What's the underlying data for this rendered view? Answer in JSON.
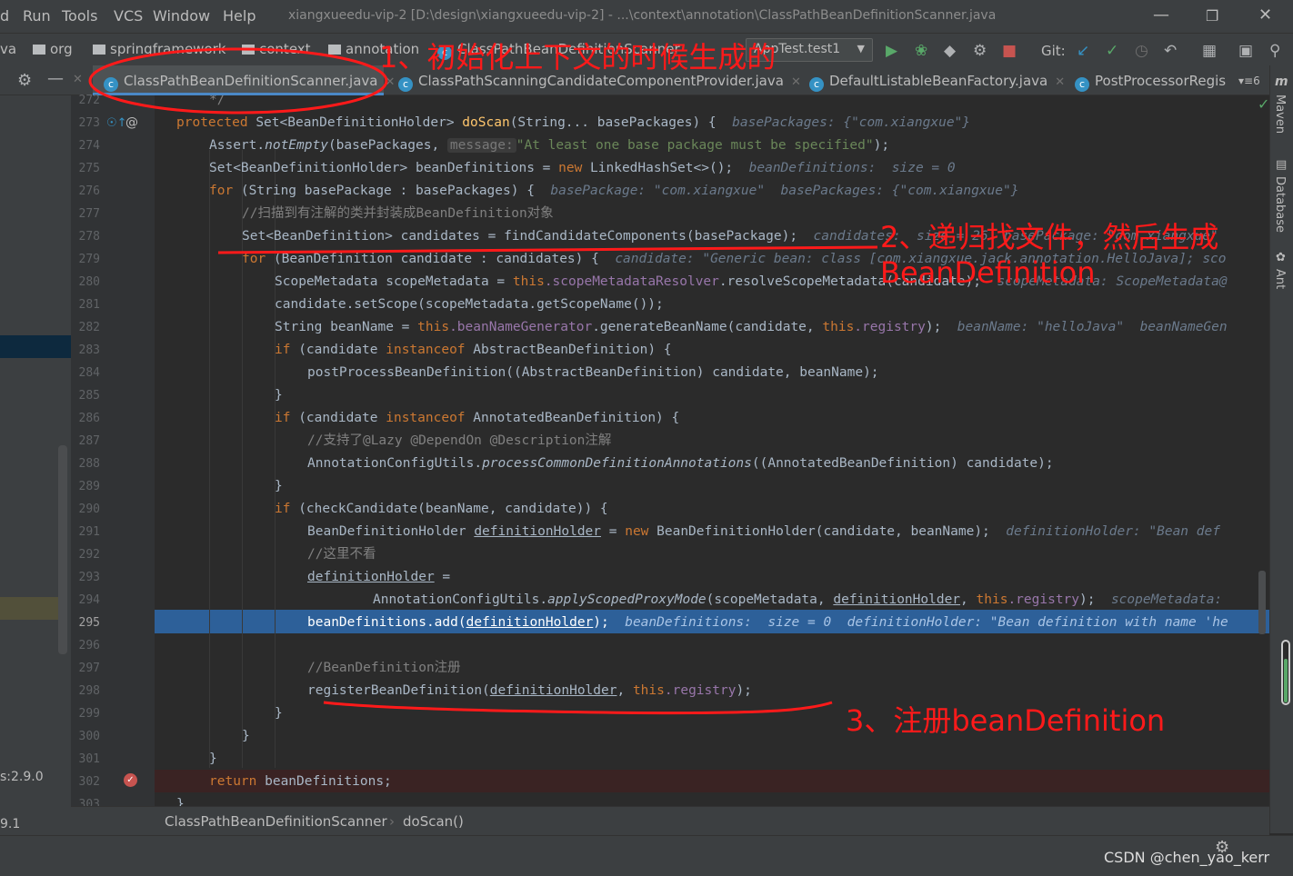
{
  "menu": {
    "items": [
      "d",
      "Run",
      "Tools",
      "VCS",
      "Window",
      "Help"
    ]
  },
  "window_title": "xiangxueedu-vip-2 [D:\\design\\xiangxueedu-vip-2] - ...\\context\\annotation\\ClassPathBeanDefinitionScanner.java",
  "breadcrumbs": [
    "va",
    "org",
    "springframework",
    "context",
    "annotation",
    "ClassPathBeanDefinitionScanner"
  ],
  "run_config": "AppTest.test1",
  "git_label": "Git:",
  "tabs": [
    {
      "label": "ClassPathBeanDefinitionScanner.java",
      "icon": "c"
    },
    {
      "label": "ClassPathScanningCandidateComponentProvider.java",
      "icon": "c"
    },
    {
      "label": "DefaultListableBeanFactory.java",
      "icon": "c"
    },
    {
      "label": "PostProcessorRegis",
      "icon": "c"
    }
  ],
  "tab_overflow": "6",
  "right_panels": [
    "Maven",
    "Database",
    "Ant"
  ],
  "left_panel_texts": [
    "s:2.9.0",
    "9.1"
  ],
  "status_breadcrumb": [
    "ClassPathBeanDefinitionScanner",
    "doScan()"
  ],
  "line_numbers": [
    "272",
    "273",
    "274",
    "275",
    "276",
    "277",
    "278",
    "279",
    "280",
    "281",
    "282",
    "283",
    "284",
    "285",
    "286",
    "287",
    "288",
    "289",
    "290",
    "291",
    "292",
    "293",
    "294",
    "295",
    "296",
    "297",
    "298",
    "299",
    "300",
    "301",
    "302",
    "303"
  ],
  "code": {
    "l272": "*/",
    "l273_a": "protected ",
    "l273_b": "Set<BeanDefinitionHolder> ",
    "l273_c": "doScan",
    "l273_d": "(String... basePackages) {  ",
    "l273_hint": "basePackages: {\"com.xiangxue\"}",
    "l274_a": "Assert.",
    "l274_b": "notEmpty",
    "l274_c": "(basePackages, ",
    "l274_param": "message:",
    "l274_str": "\"At least one base package must be specified\"",
    "l274_d": ");",
    "l275_a": "Set<BeanDefinitionHolder> beanDefinitions = ",
    "l275_new": "new ",
    "l275_b": "LinkedHashSet<>();  ",
    "l275_hint": "beanDefinitions:  size = 0",
    "l276_for": "for ",
    "l276_a": "(String basePackage : basePackages) {  ",
    "l276_hint": "basePackage: \"com.xiangxue\"  basePackages: {\"com.xiangxue\"}",
    "l277": "//扫描到有注解的类并封装成BeanDefinition对象",
    "l278_a": "Set<BeanDefinition> candidates = findCandidateComponents(basePackage);  ",
    "l278_hint": "candidates:  size = 26  basePackage: \"com.xiangxue\"",
    "l279_for": "for ",
    "l279_a": "(BeanDefinition candidate : candidates) {  ",
    "l279_hint": "candidate: \"Generic bean: class [com.xiangxue.jack.annotation.HelloJava]; sco",
    "l280_a": "ScopeMetadata scopeMetadata = ",
    "l280_this": "this",
    "l280_f": ".scopeMetadataResolver",
    "l280_b": ".resolveScopeMetadata(candidate);  ",
    "l280_hint": "scopeMetadata: ScopeMetadata@",
    "l281": "candidate.setScope(scopeMetadata.getScopeName());",
    "l282_a": "String beanName = ",
    "l282_this": "this",
    "l282_f": ".beanNameGenerator",
    "l282_b": ".generateBeanName(candidate, ",
    "l282_this2": "this",
    "l282_f2": ".registry",
    "l282_c": ");  ",
    "l282_hint": "beanName: \"helloJava\"  beanNameGen",
    "l283_if": "if ",
    "l283_a": "(candidate ",
    "l283_inst": "instanceof ",
    "l283_b": "AbstractBeanDefinition) {",
    "l284": "postProcessBeanDefinition((AbstractBeanDefinition) candidate, beanName);",
    "l285": "}",
    "l286_if": "if ",
    "l286_a": "(candidate ",
    "l286_inst": "instanceof ",
    "l286_b": "AnnotatedBeanDefinition) {",
    "l287": "//支持了@Lazy @DependOn @Description注解",
    "l288_a": "AnnotationConfigUtils.",
    "l288_b": "processCommonDefinitionAnnotations",
    "l288_c": "((AnnotatedBeanDefinition) candidate);",
    "l289": "}",
    "l290_if": "if ",
    "l290_a": "(checkCandidate(beanName, candidate)) {",
    "l291_a": "BeanDefinitionHolder ",
    "l291_u": "definitionHolder",
    "l291_b": " = ",
    "l291_new": "new ",
    "l291_c": "BeanDefinitionHolder(candidate, beanName);  ",
    "l291_hint": "definitionHolder: \"Bean def",
    "l292": "//这里不看",
    "l293_u": "definitionHolder",
    "l293_b": " =",
    "l294_a": "AnnotationConfigUtils.",
    "l294_b": "applyScopedProxyMode",
    "l294_c": "(scopeMetadata, ",
    "l294_u": "definitionHolder",
    "l294_d": ", ",
    "l294_this": "this",
    "l294_f": ".registry",
    "l294_e": ");  ",
    "l294_hint": "scopeMetadata:",
    "l295_a": "beanDefinitions.add(",
    "l295_u": "definitionHolder",
    "l295_b": ");  ",
    "l295_hint": "beanDefinitions:  size = 0  definitionHolder: \"Bean definition with name 'he",
    "l297": "//BeanDefinition注册",
    "l298_a": "registerBeanDefinition(",
    "l298_u": "definitionHolder",
    "l298_b": ", ",
    "l298_this": "this",
    "l298_f": ".registry",
    "l298_c": ");",
    "l299": "}",
    "l300": "}",
    "l301": "}",
    "l302_ret": "return ",
    "l302_a": "beanDefinitions;",
    "l303": "}"
  },
  "annotations": {
    "a1": "1、初始化上下文的时候生成的",
    "a2_l1": "2、递归找文件，然后生成",
    "a2_l2": "BeanDefinition",
    "a3": "3、注册beanDefinition"
  },
  "watermark": "CSDN @chen_yao_kerr",
  "colors": {
    "annotation": "#ff1a1a",
    "execution_line": "#2d6099",
    "breakpoint_line": "#3a2323",
    "keyword": "#cc7832",
    "method": "#ffc66d",
    "string": "#6a8759",
    "comment": "#808080",
    "field": "#9876aa"
  }
}
